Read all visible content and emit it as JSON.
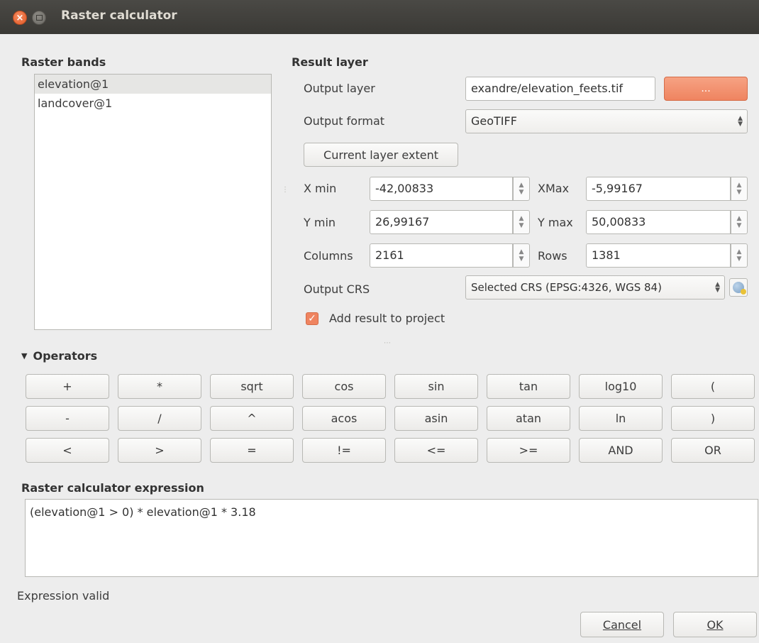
{
  "window": {
    "title": "Raster calculator"
  },
  "raster_bands": {
    "title": "Raster bands",
    "items": [
      "elevation@1",
      "landcover@1"
    ],
    "selected_index": 0
  },
  "result_layer": {
    "title": "Result layer",
    "output_layer_label": "Output layer",
    "output_layer_value": "exandre/elevation_feets.tif",
    "browse_label": "...",
    "output_format_label": "Output format",
    "output_format_value": "GeoTIFF",
    "current_extent_label": "Current layer extent",
    "xmin_label": "X min",
    "xmin_value": "-42,00833",
    "xmax_label": "XMax",
    "xmax_value": "-5,99167",
    "ymin_label": "Y min",
    "ymin_value": "26,99167",
    "ymax_label": "Y max",
    "ymax_value": "50,00833",
    "columns_label": "Columns",
    "columns_value": "2161",
    "rows_label": "Rows",
    "rows_value": "1381",
    "output_crs_label": "Output CRS",
    "output_crs_value": "Selected CRS (EPSG:4326, WGS 84)",
    "add_to_project_label": "Add result to project",
    "add_to_project_checked": true
  },
  "operators": {
    "title": "Operators",
    "row1": [
      "+",
      "*",
      "sqrt",
      "cos",
      "sin",
      "tan",
      "log10",
      "("
    ],
    "row2": [
      "-",
      "/",
      "^",
      "acos",
      "asin",
      "atan",
      "ln",
      ")"
    ],
    "row3": [
      "<",
      ">",
      "=",
      "!=",
      "<=",
      ">=",
      "AND",
      "OR"
    ]
  },
  "expression": {
    "title": "Raster calculator expression",
    "value": "(elevation@1 > 0) * elevation@1 * 3.18",
    "status": "Expression valid"
  },
  "buttons": {
    "cancel": "Cancel",
    "ok": "OK"
  },
  "colors": {
    "accent": "#ef8460",
    "titlebar": "#3c3b37",
    "background": "#ededed"
  }
}
